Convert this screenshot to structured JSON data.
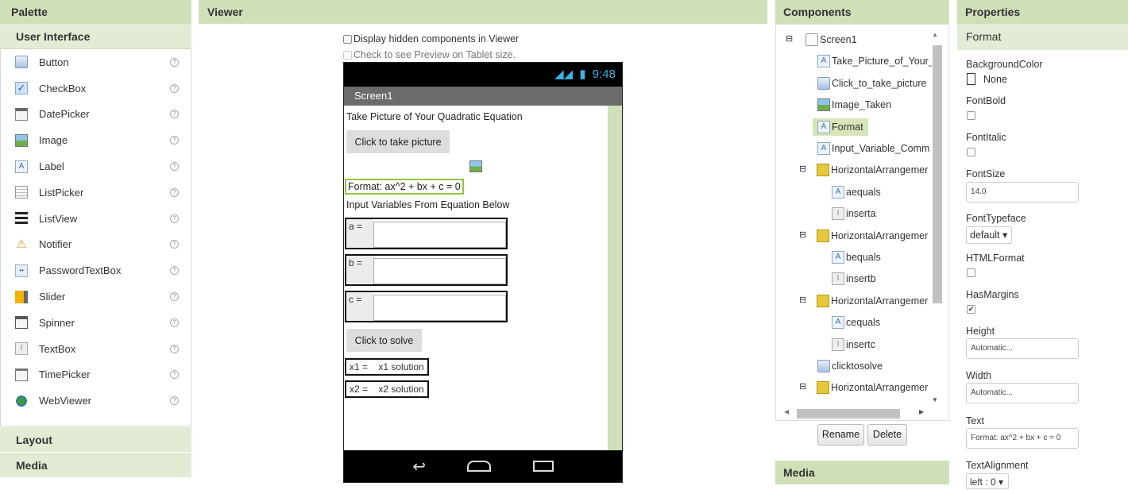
{
  "palette": {
    "title": "Palette",
    "section": "User Interface",
    "items": [
      {
        "label": "Button",
        "icon": "button-icon"
      },
      {
        "label": "CheckBox",
        "icon": "checkbox-icon"
      },
      {
        "label": "DatePicker",
        "icon": "datepicker-icon"
      },
      {
        "label": "Image",
        "icon": "image-icon"
      },
      {
        "label": "Label",
        "icon": "label-icon"
      },
      {
        "label": "ListPicker",
        "icon": "listpicker-icon"
      },
      {
        "label": "ListView",
        "icon": "listview-icon"
      },
      {
        "label": "Notifier",
        "icon": "notifier-icon"
      },
      {
        "label": "PasswordTextBox",
        "icon": "passwordtextbox-icon"
      },
      {
        "label": "Slider",
        "icon": "slider-icon"
      },
      {
        "label": "Spinner",
        "icon": "spinner-icon"
      },
      {
        "label": "TextBox",
        "icon": "textbox-icon"
      },
      {
        "label": "TimePicker",
        "icon": "timepicker-icon"
      },
      {
        "label": "WebViewer",
        "icon": "webviewer-icon"
      }
    ],
    "help_glyph": "?",
    "sections_below": [
      "Layout",
      "Media"
    ]
  },
  "viewer": {
    "title": "Viewer",
    "hidden_label": "Display hidden components in Viewer",
    "tablet_label": "Check to see Preview on Tablet size.",
    "phone": {
      "time": "9:48",
      "screen_title": "Screen1",
      "take_label": "Take Picture of Your Quadratic Equation",
      "take_button": "Click to take picture",
      "format_label": "Format: ax^2 + bx + c = 0",
      "input_label": "Input Variables From Equation Below",
      "a_label": "a =",
      "b_label": "b =",
      "c_label": "c =",
      "solve_button": "Click to solve",
      "x1_text": "x1 =    x1 solution",
      "x2_text": "x2 =    x2 solution"
    }
  },
  "components": {
    "title": "Components",
    "tree": [
      {
        "label": "Screen1",
        "icon": "screen-icon",
        "toggle": "⊟"
      },
      {
        "label": "Take_Picture_of_Your_",
        "icon": "label-icon"
      },
      {
        "label": "Click_to_take_picture",
        "icon": "button-icon"
      },
      {
        "label": "Image_Taken",
        "icon": "image-icon"
      },
      {
        "label": "Format",
        "icon": "label-icon",
        "selected": true
      },
      {
        "label": "Input_Variable_Comm",
        "icon": "label-icon"
      },
      {
        "label": "HorizontalArrangemer",
        "icon": "horizontal-arrangement-icon",
        "toggle": "⊟"
      },
      {
        "label": "aequals",
        "icon": "label-icon"
      },
      {
        "label": "inserta",
        "icon": "textbox-icon"
      },
      {
        "label": "HorizontalArrangemer",
        "icon": "horizontal-arrangement-icon",
        "toggle": "⊟"
      },
      {
        "label": "bequals",
        "icon": "label-icon"
      },
      {
        "label": "insertb",
        "icon": "textbox-icon"
      },
      {
        "label": "HorizontalArrangemer",
        "icon": "horizontal-arrangement-icon",
        "toggle": "⊟"
      },
      {
        "label": "cequals",
        "icon": "label-icon"
      },
      {
        "label": "insertc",
        "icon": "textbox-icon"
      },
      {
        "label": "clicktosolve",
        "icon": "button-icon"
      },
      {
        "label": "HorizontalArrangemer",
        "icon": "horizontal-arrangement-icon",
        "toggle": "⊟"
      }
    ],
    "rename": "Rename",
    "delete": "Delete",
    "media_title": "Media"
  },
  "properties": {
    "title": "Properties",
    "component": "Format",
    "bgcolor_label": "BackgroundColor",
    "bgcolor_value": "None",
    "fontbold_label": "FontBold",
    "fontitalic_label": "FontItalic",
    "fontsize_label": "FontSize",
    "fontsize_value": "14.0",
    "fonttypeface_label": "FontTypeface",
    "fonttypeface_value": "default ▾",
    "htmlformat_label": "HTMLFormat",
    "hasmargins_label": "HasMargins",
    "hasmargins_check": "✔",
    "height_label": "Height",
    "height_value": "Automatic...",
    "width_label": "Width",
    "width_value": "Automatic...",
    "text_label": "Text",
    "text_value": "Format: ax^2 + bx + c = 0",
    "textalign_label": "TextAlignment",
    "textalign_value": "left : 0 ▾"
  },
  "colors": {
    "header_green": "#cfe0b8",
    "subheader_green": "#e2ecd5",
    "selected_green": "#d6e6b8",
    "format_border": "#8dc63f"
  }
}
